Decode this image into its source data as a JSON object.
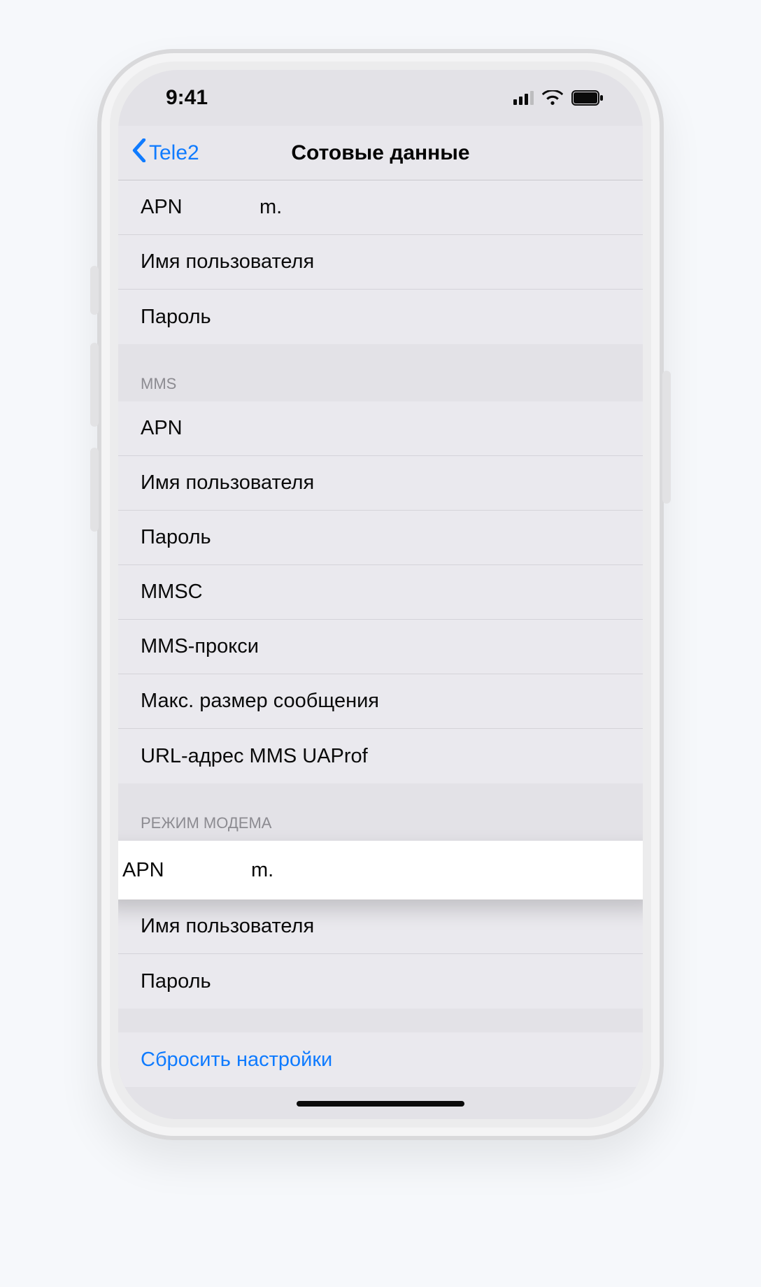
{
  "status": {
    "time": "9:41"
  },
  "nav": {
    "back_label": "Tele2",
    "title": "Сотовые данные"
  },
  "colors": {
    "accent": "#0f7bff"
  },
  "section_top": {
    "rows": {
      "apn": {
        "label": "APN",
        "value": "m."
      },
      "user": {
        "label": "Имя пользователя",
        "value": ""
      },
      "password": {
        "label": "Пароль",
        "value": ""
      }
    }
  },
  "section_mms": {
    "header": "MMS",
    "rows": {
      "apn": {
        "label": "APN"
      },
      "user": {
        "label": "Имя пользователя"
      },
      "password": {
        "label": "Пароль"
      },
      "mmsc": {
        "label": "MMSC"
      },
      "proxy": {
        "label": "MMS-прокси"
      },
      "maxsize": {
        "label": "Макс. размер сообщения"
      },
      "uaprof": {
        "label": "URL-адрес MMS UAProf"
      }
    }
  },
  "section_modem": {
    "header": "РЕЖИМ МОДЕМА",
    "rows": {
      "apn": {
        "label": "APN",
        "value": "m."
      },
      "user": {
        "label": "Имя пользователя",
        "value": ""
      },
      "password": {
        "label": "Пароль",
        "value": ""
      }
    }
  },
  "reset": {
    "label": "Сбросить настройки"
  }
}
